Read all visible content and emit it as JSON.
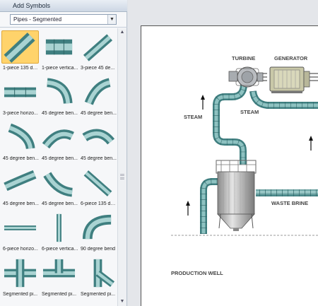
{
  "panel": {
    "title": "Add Symbols",
    "dropdown_value": "Pipes - Segmented",
    "symbols": [
      {
        "label": "1-piece 135 de...",
        "icon": "pipe-135-degree-icon",
        "selected": true
      },
      {
        "label": "1-piece vertica...",
        "icon": "pipe-straight-vertical-icon"
      },
      {
        "label": "3-piece 45 de...",
        "icon": "pipe-45-degree-3piece-icon"
      },
      {
        "label": "3-piece horizo...",
        "icon": "pipe-horizontal-3piece-icon"
      },
      {
        "label": "45 degree ben...",
        "icon": "pipe-45-bend-icon"
      },
      {
        "label": "45 degree ben...",
        "icon": "pipe-45-bend-icon"
      },
      {
        "label": "45 degree ben...",
        "icon": "pipe-45-bend-icon"
      },
      {
        "label": "45 degree ben...",
        "icon": "pipe-45-bend-icon"
      },
      {
        "label": "45 degree ben...",
        "icon": "pipe-45-bend-icon"
      },
      {
        "label": "45 degree ben...",
        "icon": "pipe-45-bend-icon"
      },
      {
        "label": "45 degree ben...",
        "icon": "pipe-45-bend-icon"
      },
      {
        "label": "6-piece 135 de...",
        "icon": "pipe-135-degree-6piece-icon"
      },
      {
        "label": "6-piece horizo...",
        "icon": "pipe-horizontal-6piece-icon"
      },
      {
        "label": "6-piece vertica...",
        "icon": "pipe-vertical-6piece-icon"
      },
      {
        "label": "90 degree bend",
        "icon": "pipe-90-bend-icon"
      },
      {
        "label": "Segmented pi...",
        "icon": "pipe-cross-icon"
      },
      {
        "label": "Segmented pi...",
        "icon": "pipe-tee-icon"
      },
      {
        "label": "Segmented pi...",
        "icon": "pipe-tee-angled-icon"
      }
    ]
  },
  "diagram": {
    "labels": {
      "turbine": "TURBINE",
      "generator": "GENERATOR",
      "steam_left": "STEAM",
      "steam_mid": "STEAM",
      "waste_brine": "WASTE BRINE",
      "production_well": "PRODUCTION WELL"
    },
    "colors": {
      "pipe": "#6fa9aa",
      "pipe_dark": "#3f7f80",
      "pipe_light": "#a9d3d2",
      "selected": "#ffd36b"
    }
  }
}
